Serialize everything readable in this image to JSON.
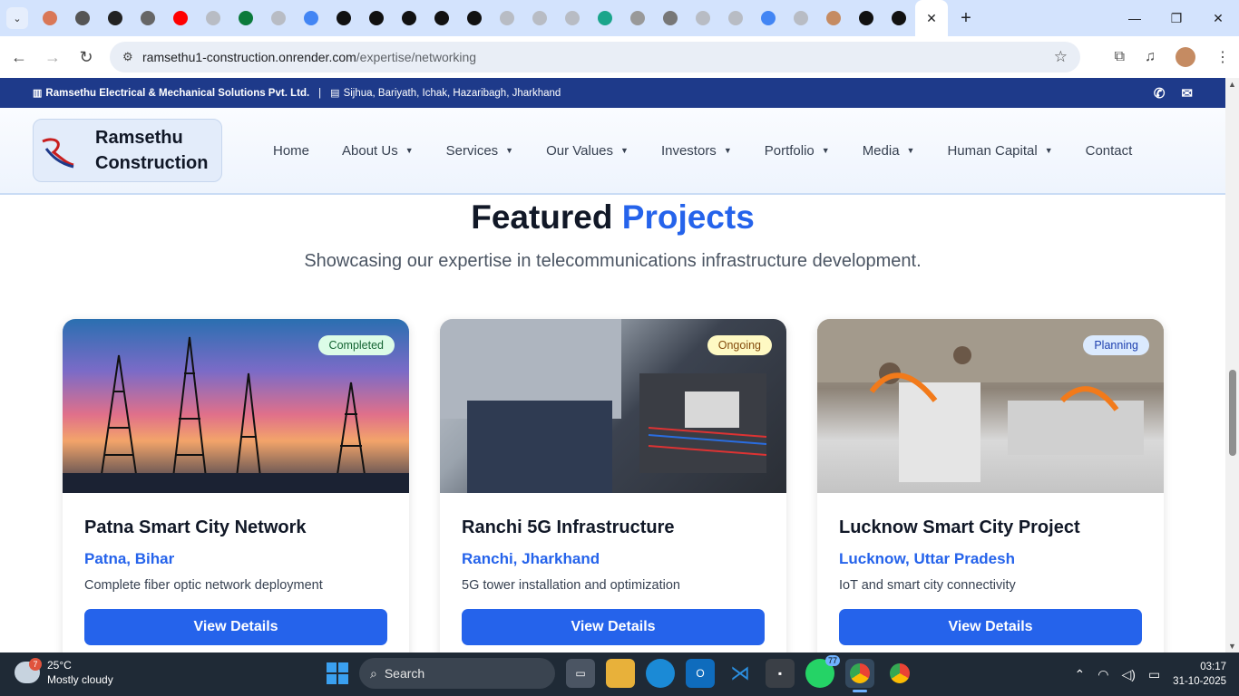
{
  "browser": {
    "tab_count_favicons": [
      "claude",
      "chatgpt",
      "x",
      "chrome",
      "youtube",
      "tab",
      "leaf",
      "tab",
      "google",
      "link",
      "link",
      "link",
      "link",
      "link",
      "tab",
      "tab",
      "tab",
      "diamond",
      "arrow",
      "move",
      "tab",
      "tab",
      "google",
      "tab",
      "user",
      "github",
      "github"
    ],
    "active_tab_close": "✕",
    "url_host": "ramsethu1-construction.onrender.com",
    "url_path": "/expertise/networking"
  },
  "infobar": {
    "company": "Ramsethu Electrical & Mechanical Solutions Pvt. Ltd.",
    "separator": "|",
    "address": "Sijhua, Bariyath, Ichak, Hazaribagh, Jharkhand"
  },
  "header": {
    "brand_line1": "Ramsethu",
    "brand_line2": "Construction",
    "nav": [
      {
        "label": "Home",
        "dropdown": false
      },
      {
        "label": "About Us",
        "dropdown": true
      },
      {
        "label": "Services",
        "dropdown": true
      },
      {
        "label": "Our Values",
        "dropdown": true
      },
      {
        "label": "Investors",
        "dropdown": true
      },
      {
        "label": "Portfolio",
        "dropdown": true
      },
      {
        "label": "Media",
        "dropdown": true
      },
      {
        "label": "Human Capital",
        "dropdown": true
      },
      {
        "label": "Contact",
        "dropdown": false
      }
    ]
  },
  "section": {
    "title_part1": "Featured",
    "title_part2": "Projects",
    "subtitle": "Showcasing our expertise in telecommunications infrastructure development."
  },
  "projects": [
    {
      "status": "Completed",
      "title": "Patna Smart City Network",
      "location": "Patna, Bihar",
      "description": "Complete fiber optic network deployment",
      "button": "View Details"
    },
    {
      "status": "Ongoing",
      "title": "Ranchi 5G Infrastructure",
      "location": "Ranchi, Jharkhand",
      "description": "5G tower installation and optimization",
      "button": "View Details"
    },
    {
      "status": "Planning",
      "title": "Lucknow Smart City Project",
      "location": "Lucknow, Uttar Pradesh",
      "description": "IoT and smart city connectivity",
      "button": "View Details"
    }
  ],
  "colors": {
    "accent": "#2563eb",
    "infobar_bg": "#1e3a8a",
    "badge_completed_bg": "#dcfce7",
    "badge_ongoing_bg": "#fef9c3",
    "badge_planning_bg": "#dbeafe"
  },
  "taskbar": {
    "weather_badge": "7",
    "temperature": "25°C",
    "weather": "Mostly cloudy",
    "search_label": "Search",
    "whatsapp_badge": "77",
    "time": "03:17",
    "date": "31-10-2025"
  }
}
